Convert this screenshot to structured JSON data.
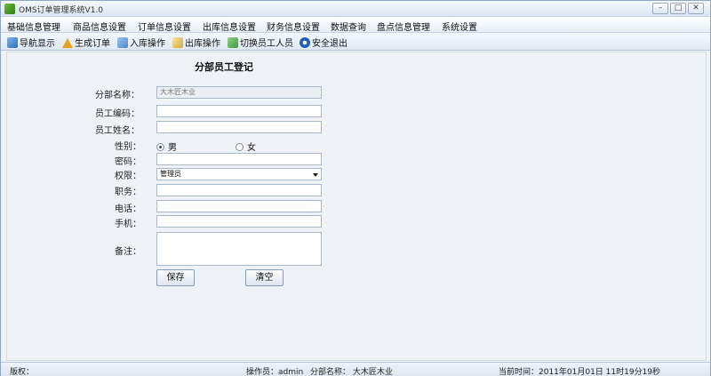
{
  "window": {
    "title": "OMS订单管理系统V1.0",
    "min_glyph": "–",
    "max_glyph": "□",
    "close_glyph": "✕"
  },
  "menu": [
    "基础信息管理",
    "商品信息设置",
    "订单信息设置",
    "出库信息设置",
    "财务信息设置",
    "数据查询",
    "盘点信息管理",
    "系统设置"
  ],
  "toolbar": {
    "nav": "导航显示",
    "generate": "生成订单",
    "inbound": "入库操作",
    "outbound": "出库操作",
    "switch_user": "切换员工人员",
    "logout": "安全退出"
  },
  "form": {
    "title": "分部员工登记",
    "branch_label": "分部名称：",
    "branch_value": "大木匠木业",
    "code_label": "员工编码：",
    "name_label": "员工姓名：",
    "gender_label": "性别：",
    "gender_male": "男",
    "gender_female": "女",
    "password_label": "密码：",
    "permission_label": "权限：",
    "permission_value": "管理员",
    "position_label": "职务：",
    "phone_label": "电话：",
    "mobile_label": "手机：",
    "remark_label": "备注：",
    "save": "保存",
    "clear": "清空"
  },
  "status": {
    "copyright": "版权：",
    "operator": "操作员：admin",
    "branch": "分部名称： 大木匠木业",
    "time": "当前时间：2011年01月01日 11时19分19秒"
  }
}
